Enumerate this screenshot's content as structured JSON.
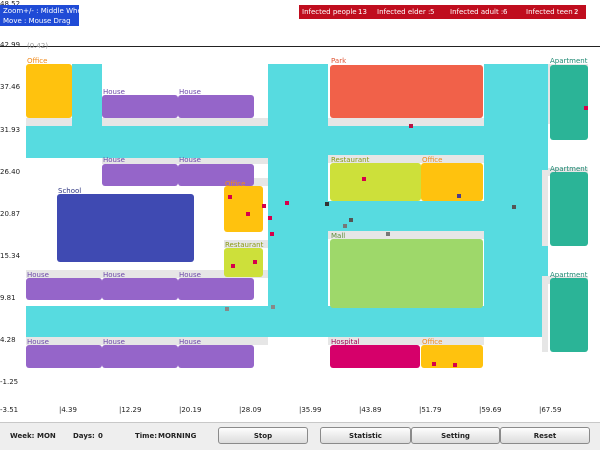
{
  "overlay": {
    "zoom_hint": "Zoom+/- : Middle Wheel",
    "move_hint": "Move : Mouse Drag",
    "coordinate_readout": "(0.42)"
  },
  "infection_stats": {
    "people_label": "Infected people :",
    "people_value": "13",
    "elder_label": "Infected elder :",
    "elder_value": "5",
    "adult_label": "Infected adult :",
    "adult_value": "6",
    "teen_label": "Infected teen :",
    "teen_value": "2"
  },
  "axes": {
    "y_ticks": [
      "48.52",
      "42.99",
      "37.46",
      "31.93",
      "26.40",
      "20.87",
      "15.34",
      "9.81",
      "4.28",
      "-1.25",
      "-3.51"
    ],
    "x_ticks": [
      "|4.39",
      "|12.29",
      "|20.19",
      "|28.09",
      "|35.99",
      "|43.89",
      "|51.79",
      "|59.69",
      "|67.59"
    ]
  },
  "buildings": {
    "office_1": "Office",
    "house_1": "House",
    "house_2": "House",
    "park": "Park",
    "apartment_1": "Apartment",
    "house_3": "House",
    "house_4": "House",
    "restaurant_1": "Restaurant",
    "office_2": "Office",
    "apartment_2": "Apartment",
    "school": "School",
    "office_3": "Office",
    "mall": "Mall",
    "restaurant_2": "Restaurant",
    "house_5": "House",
    "house_6": "House",
    "house_7": "House",
    "apartment_3": "Apartment",
    "house_8": "House",
    "house_9": "House",
    "house_10": "House",
    "hospital": "Hospital",
    "office_4": "Office"
  },
  "building_colors": {
    "office": "#ffc20e",
    "house": "#9565c9",
    "park": "#f16149",
    "apartment": "#2bb497",
    "restaurant": "#cde03a",
    "school": "#3f4ab2",
    "mall": "#9ed86a",
    "hospital": "#d6006a",
    "road": "#57dbe0"
  },
  "status_bar": {
    "week_label": "Week:",
    "week_value": "MON",
    "days_label": "Days:",
    "days_value": "0",
    "time_label": "Time:",
    "time_value": "MORNING"
  },
  "buttons": {
    "stop": "Stop",
    "statistic": "Statistic",
    "setting": "Setting",
    "reset": "Reset"
  }
}
